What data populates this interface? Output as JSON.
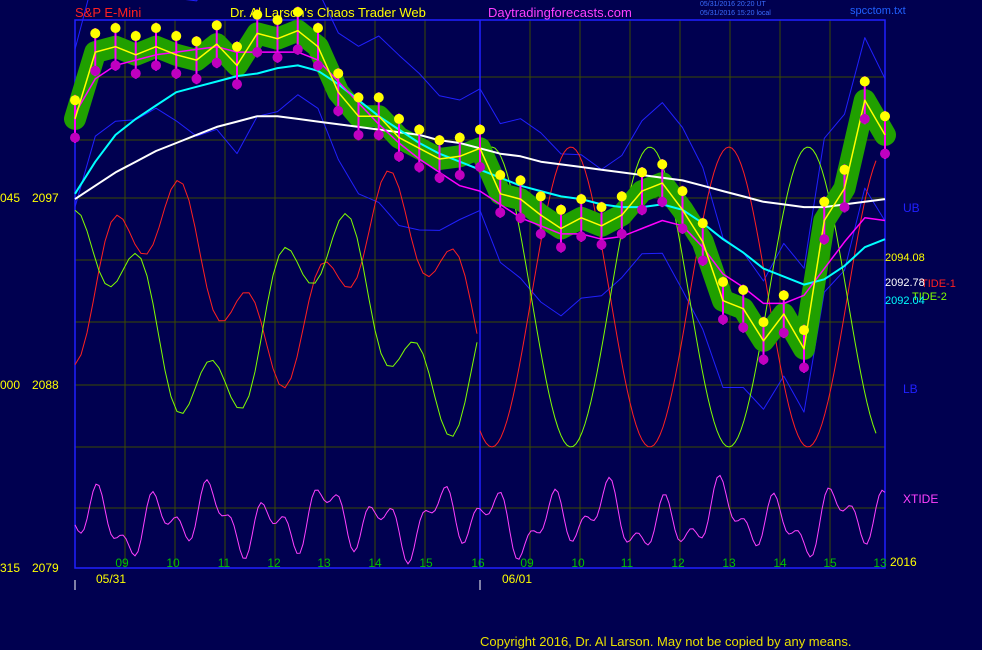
{
  "header": {
    "instrument": "S&P E-Mini",
    "author": "Dr. Al Larson's Chaos Trader Web",
    "site": "Daytradingforecasts.com",
    "stamp_ut": "05/31/2016 20:20 UT",
    "stamp_local": "05/31/2016 15:20 local",
    "file": "spcctom.txt"
  },
  "footer": {
    "copyright": "Copyright 2016, Dr. Al Larson. May not be copied by any means."
  },
  "colors": {
    "background": "#000050",
    "plot_border": "#2020ff",
    "grid": "#3c4a00",
    "price": "#ffff00",
    "bars": "#ff00ff",
    "fast_avg": "#00ffff",
    "slow_avg": "#ffffff",
    "band": "#2020ff",
    "tide1": "#ff2020",
    "tide2": "#80ff00",
    "xtide": "#ff40ff",
    "high_dot": "#ffff00",
    "low_dot": "#c000c0",
    "aura": "#20a000"
  },
  "chart_data": {
    "type": "line",
    "title": "S&P E-Mini",
    "ylim": [
      2079,
      2099.5
    ],
    "price_ticks": [
      2097,
      2088,
      2079
    ],
    "left_ticks": [
      "045",
      "000",
      "315"
    ],
    "hour_labels": [
      "09",
      "10",
      "11",
      "12",
      "13",
      "14",
      "15",
      "16",
      "09",
      "10",
      "11",
      "12",
      "13",
      "14",
      "15",
      "13"
    ],
    "date_labels": [
      "05/31",
      "06/01"
    ],
    "right_labels": {
      "ub": "UB",
      "lb": "LB",
      "xtide": "XTIDE",
      "year": "2016",
      "tide1": "TIDE-1",
      "tide2": "TIDE-2",
      "v1": "2094.08",
      "v2": "2092.78",
      "v3": "2092.04"
    },
    "x": [
      0,
      2,
      4,
      6,
      8,
      10,
      12,
      14,
      16,
      18,
      20,
      22,
      24,
      26,
      28,
      30,
      32,
      34,
      36,
      38,
      40,
      42,
      44,
      46,
      48,
      50,
      52,
      54,
      56,
      58,
      60,
      62,
      64,
      66,
      68,
      70,
      72,
      74,
      76,
      78,
      80
    ],
    "series": [
      {
        "values": [
          2095.8,
          2098.3,
          2098.5,
          2098.2,
          2098.5,
          2098.2,
          2098.0,
          2098.6,
          2097.8,
          2099.0,
          2098.8,
          2099.1,
          2098.5,
          2096.8,
          2095.9,
          2095.9,
          2095.1,
          2094.7,
          2094.3,
          2094.4,
          2094.7,
          2093.0,
          2092.8,
          2092.2,
          2091.7,
          2092.1,
          2091.8,
          2092.2,
          2093.1,
          2093.4,
          2092.4,
          2091.2,
          2089.0,
          2088.7,
          2087.5,
          2088.5,
          2087.2,
          2092.0,
          2093.2,
          2096.5,
          2095.2
        ]
      },
      {
        "values": [
          2096.0,
          2097.3,
          2097.8,
          2098.0,
          2098.2,
          2098.3,
          2098.4,
          2098.5,
          2098.3,
          2098.3,
          2098.3,
          2098.3,
          2098.0,
          2097.2,
          2096.4,
          2095.6,
          2094.9,
          2094.3,
          2093.8,
          2093.3,
          2093.1,
          2092.6,
          2092.1,
          2091.8,
          2091.5,
          2091.5,
          2091.3,
          2091.4,
          2091.7,
          2092.0,
          2091.8,
          2091.0,
          2090.0,
          2089.5,
          2088.9,
          2088.9,
          2089.2,
          2090.2,
          2091.2,
          2092.1,
          2092.0
        ]
      },
      {
        "values": [
          2093.0,
          2094.2,
          2095.2,
          2095.8,
          2096.3,
          2096.8,
          2097.0,
          2097.2,
          2097.4,
          2097.5,
          2097.7,
          2097.8,
          2097.6,
          2097.1,
          2096.5,
          2095.9,
          2095.4,
          2094.9,
          2094.5,
          2094.2,
          2093.9,
          2093.6,
          2093.3,
          2093.1,
          2092.9,
          2092.8,
          2092.6,
          2092.5,
          2092.5,
          2092.6,
          2092.4,
          2091.9,
          2091.3,
          2090.8,
          2090.2,
          2089.9,
          2089.6,
          2089.8,
          2090.3,
          2091.0,
          2091.3
        ]
      },
      {
        "values": [
          2092.8,
          2093.3,
          2093.8,
          2094.2,
          2094.6,
          2094.9,
          2095.2,
          2095.5,
          2095.7,
          2095.9,
          2095.9,
          2095.8,
          2095.7,
          2095.6,
          2095.5,
          2095.4,
          2095.3,
          2095.2,
          2095.0,
          2094.9,
          2094.7,
          2094.5,
          2094.4,
          2094.2,
          2094.1,
          2094.0,
          2093.9,
          2093.8,
          2093.7,
          2093.6,
          2093.5,
          2093.3,
          2093.1,
          2092.9,
          2092.7,
          2092.6,
          2092.5,
          2092.5,
          2092.6,
          2092.7,
          2092.8
        ]
      }
    ]
  }
}
